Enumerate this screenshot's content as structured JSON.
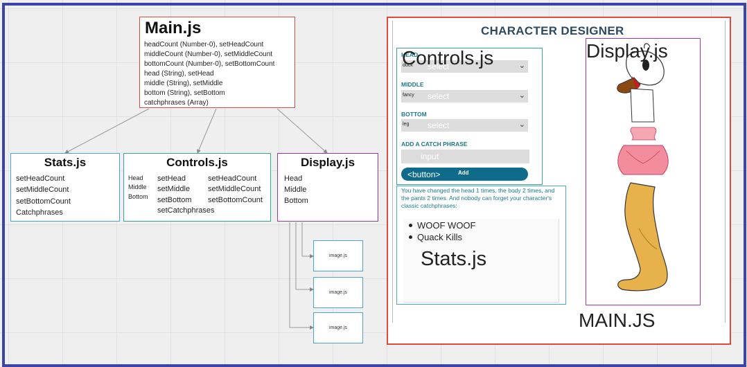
{
  "main": {
    "title": "Main.js",
    "lines": [
      "headCount (Number-0), setHeadCount",
      "middleCount (Number-0), setMiddleCount",
      "bottomCount (Number-0), setBottomCount",
      "head (String), setHead",
      "middle (String), setMiddle",
      "bottom (String), setBottom",
      "catchphrases (Array)"
    ]
  },
  "stats": {
    "title": "Stats.js",
    "lines": [
      "setHeadCount",
      "setMiddleCount",
      "setBottomCount",
      "Catchphrases"
    ]
  },
  "controls": {
    "title": "Controls.js",
    "props": [
      "Head",
      "Middle",
      "Bottom"
    ],
    "col1": [
      "setHead",
      "setMiddle",
      "setBottom",
      "setCatchphrases"
    ],
    "col2": [
      "setHeadCount",
      "setMiddleCount",
      "setBottomCount"
    ]
  },
  "display": {
    "title": "Display.js",
    "lines": [
      "Head",
      "Middle",
      "Bottom"
    ]
  },
  "image_boxes": [
    "image.js",
    "image.js",
    "image.js"
  ],
  "screenshot": {
    "heading": "CHARACTER DESIGNER",
    "head_label": "HEAD",
    "head_value": "duck",
    "middle_label": "MIDDLE",
    "middle_value": "fancy",
    "bottom_label": "BOTTOM",
    "bottom_value": "leg",
    "catch_label": "ADD A CATCH PHRASE",
    "select_placeholder": "select",
    "input_placeholder": "input",
    "button_tag": "<button>",
    "button_label": "Add",
    "stats_message": "You have changed the head 1 times, the body 2 times, and the pants 2 times. And nobody can forget your character's classic catchphrases:",
    "phrases": [
      "WOOF WOOF",
      "Quack Kills"
    ],
    "overlay_controls": "Controls.js",
    "overlay_stats": "Stats.js",
    "overlay_display": "Display.js",
    "overlay_main": "MAIN.JS"
  },
  "colors": {
    "frame": "#3d44a8",
    "main_border": "#e04a3a",
    "stats_border": "#4aa3e0",
    "controls_border": "#33a890",
    "display_border": "#a033b0",
    "button": "#0f6b8a"
  }
}
